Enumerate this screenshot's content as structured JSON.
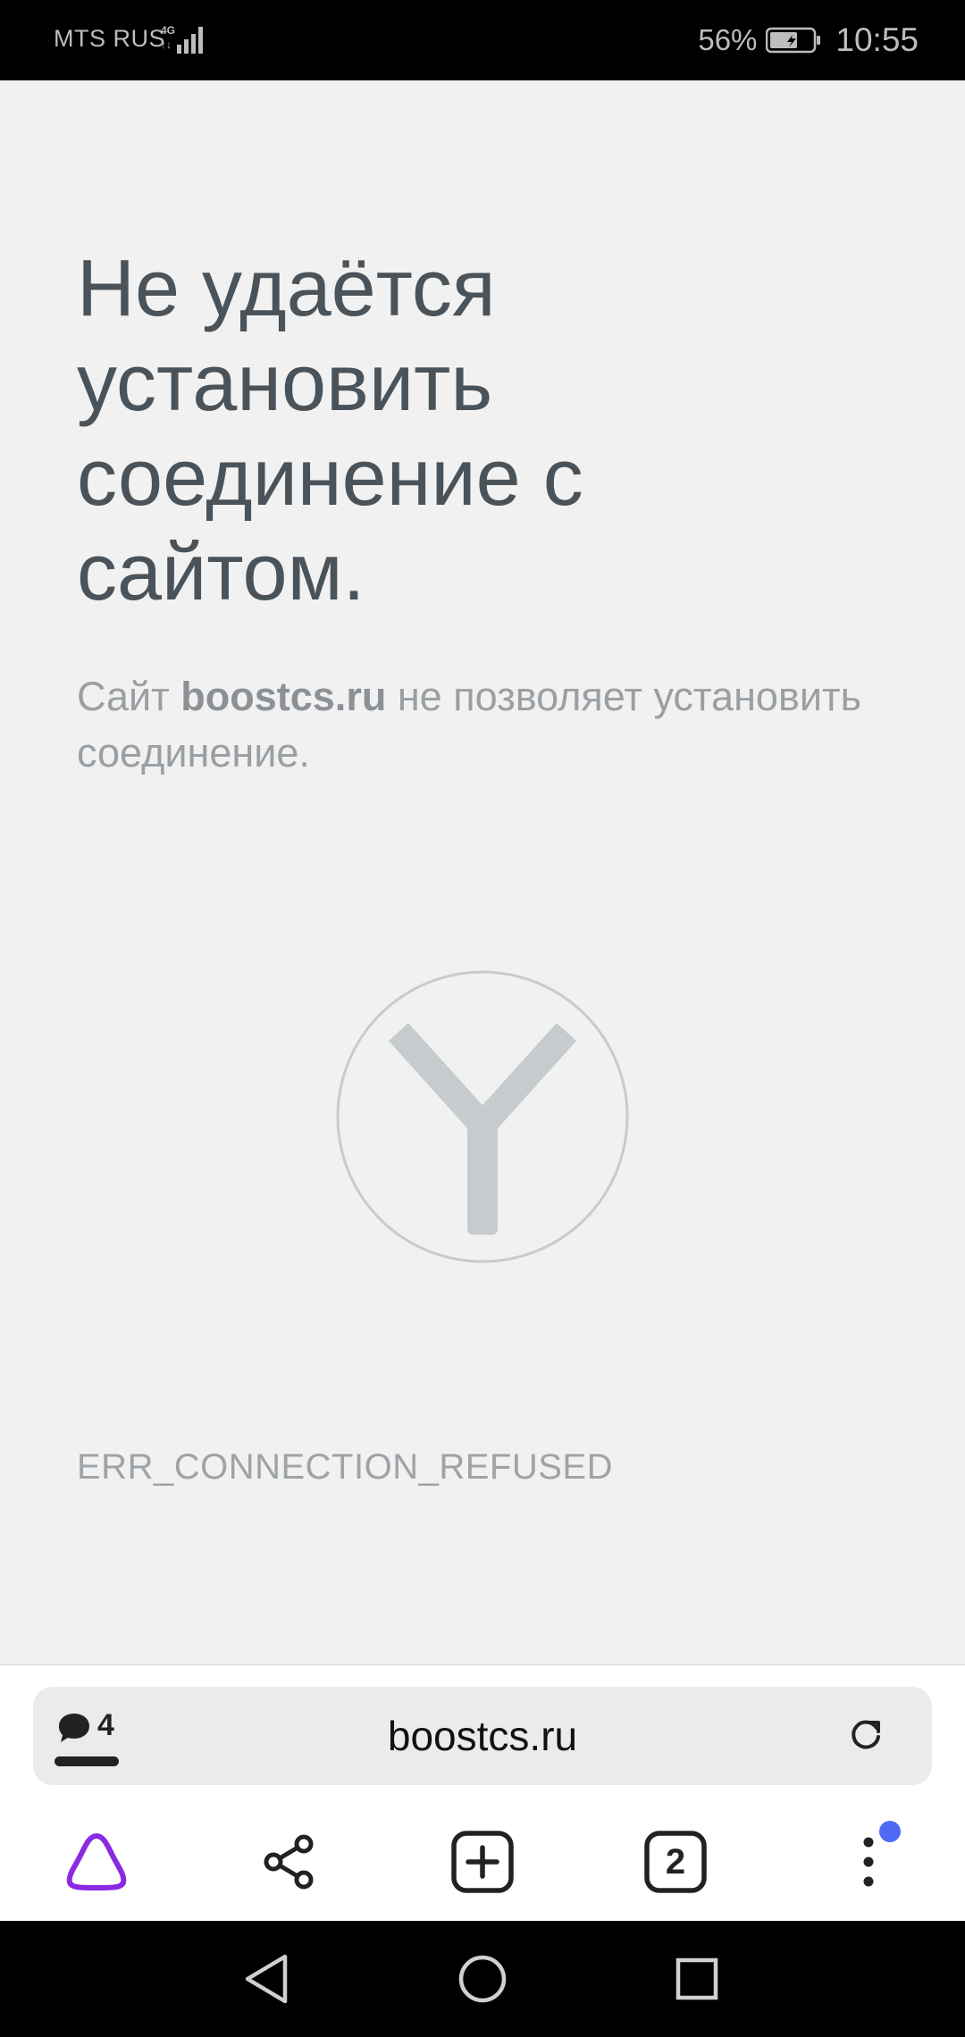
{
  "status_bar": {
    "carrier": "MTS RUS",
    "network": "4G",
    "battery_percent": "56%",
    "time": "10:55"
  },
  "error_page": {
    "title": "Не удаётся установить соединение с сайтом.",
    "description_prefix": "Сайт ",
    "description_site": "boostcs.ru",
    "description_suffix": " не позволяет установить соединение.",
    "error_code": "ERR_CONNECTION_REFUSED",
    "logo_icon": "yandex-browser-logo-icon"
  },
  "address_bar": {
    "comments_count": "4",
    "url": "boostcs.ru",
    "reload_icon": "reload-icon"
  },
  "toolbar": {
    "items": [
      "alice-icon",
      "share-icon",
      "new-tab-icon",
      "tabs-icon",
      "menu-icon"
    ],
    "tabs_count": "2",
    "accent_color": "#8a2be2",
    "notification_color": "#4f6af5"
  },
  "nav_bar": {
    "items": [
      "back-icon",
      "home-icon",
      "recents-icon"
    ]
  }
}
